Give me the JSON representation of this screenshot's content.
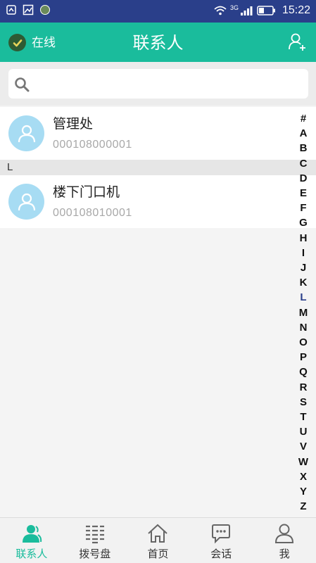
{
  "status_bar": {
    "time": "15:22",
    "network": "3G"
  },
  "header": {
    "status": "在线",
    "title": "联系人"
  },
  "search": {
    "placeholder": "",
    "value": ""
  },
  "contacts": [
    {
      "name": "管理处",
      "number": "000108000001"
    },
    {
      "section": "L"
    },
    {
      "name": "楼下门口机",
      "number": "000108010001"
    }
  ],
  "index_bar": [
    "#",
    "A",
    "B",
    "C",
    "D",
    "E",
    "F",
    "G",
    "H",
    "I",
    "J",
    "K",
    "L",
    "M",
    "N",
    "O",
    "P",
    "Q",
    "R",
    "S",
    "T",
    "U",
    "V",
    "W",
    "X",
    "Y",
    "Z"
  ],
  "index_active": "L",
  "bottom_nav": [
    {
      "label": "联系人",
      "icon": "contacts-icon",
      "active": true
    },
    {
      "label": "拨号盘",
      "icon": "dialpad-icon",
      "active": false
    },
    {
      "label": "首页",
      "icon": "home-icon",
      "active": false
    },
    {
      "label": "会话",
      "icon": "chat-icon",
      "active": false
    },
    {
      "label": "我",
      "icon": "profile-icon",
      "active": false
    }
  ],
  "colors": {
    "header": "#1abc9c",
    "status_bar": "#2a3f8a",
    "avatar": "#a7dcf3",
    "online": "#2e5b34"
  }
}
